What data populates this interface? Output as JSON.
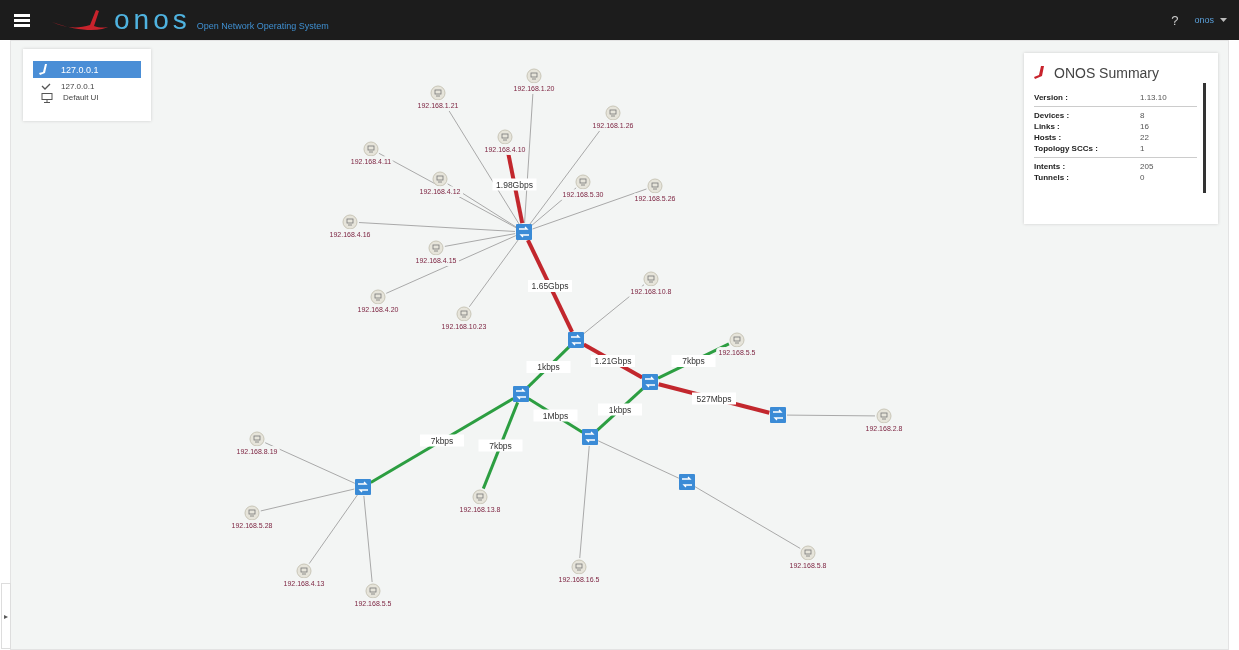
{
  "top_bar": {
    "app_name": "onos",
    "subtitle": "Open Network Operating System",
    "help": "?",
    "user": "onos"
  },
  "instance_panel": {
    "instance": {
      "label": "127.0.0.1",
      "selected": true
    },
    "details": [
      {
        "kind": "check",
        "label": "127.0.0.1"
      },
      {
        "kind": "monitor",
        "label": "Default UI"
      }
    ]
  },
  "summary_panel": {
    "title": "ONOS Summary",
    "groups": [
      [
        {
          "label": "Version :",
          "value": "1.13.10"
        }
      ],
      [
        {
          "label": "Devices :",
          "value": "8"
        },
        {
          "label": "Links :",
          "value": "16"
        },
        {
          "label": "Hosts :",
          "value": "22"
        },
        {
          "label": "Topology SCCs :",
          "value": "1"
        }
      ],
      [
        {
          "label": "Intents :",
          "value": "205"
        },
        {
          "label": "Tunnels :",
          "value": "0"
        }
      ]
    ]
  },
  "topology": {
    "hosts": [
      {
        "label": "192.168.1.20"
      },
      {
        "label": "192.168.1.21"
      },
      {
        "label": "192.168.1.26"
      },
      {
        "label": "192.168.4.10"
      },
      {
        "label": "192.168.4.11"
      },
      {
        "label": "192.168.4.12"
      },
      {
        "label": "192.168.5.30"
      },
      {
        "label": "192.168.5.26"
      },
      {
        "label": "192.168.4.16"
      },
      {
        "label": "192.168.4.15"
      },
      {
        "label": "192.168.4.20"
      },
      {
        "label": "192.168.10.23"
      },
      {
        "label": "192.168.10.8"
      },
      {
        "label": "192.168.5.5"
      },
      {
        "label": "192.168.2.8"
      },
      {
        "label": "192.168.8.19"
      },
      {
        "label": "192.168.5.28"
      },
      {
        "label": "192.168.4.13"
      },
      {
        "label": "192.168.5.5"
      },
      {
        "label": "192.168.13.8"
      },
      {
        "label": "192.168.16.5"
      },
      {
        "label": "192.168.5.8"
      }
    ],
    "links": [
      {
        "kind": "host"
      },
      {
        "kind": "host"
      },
      {
        "kind": "host"
      },
      {
        "kind": "heavy",
        "label": "1.98Gbps"
      },
      {
        "kind": "host"
      },
      {
        "kind": "host"
      },
      {
        "kind": "host"
      },
      {
        "kind": "host"
      },
      {
        "kind": "host"
      },
      {
        "kind": "host"
      },
      {
        "kind": "host"
      },
      {
        "kind": "host"
      },
      {
        "kind": "heavy",
        "label": "1.65Gbps"
      },
      {
        "kind": "host"
      },
      {
        "kind": "heavy",
        "label": "1.21Gbps"
      },
      {
        "kind": "light",
        "label": "1kbps"
      },
      {
        "kind": "light",
        "label": "7kbps"
      },
      {
        "kind": "heavy",
        "label": "527Mbps"
      },
      {
        "kind": "host"
      },
      {
        "kind": "light",
        "label": "1kbps"
      },
      {
        "kind": "light",
        "label": "1Mbps"
      },
      {
        "kind": "light",
        "label": "7kbps"
      },
      {
        "kind": "light",
        "label": "7kbps"
      },
      {
        "kind": "host"
      },
      {
        "kind": "host"
      },
      {
        "kind": "host"
      },
      {
        "kind": "host"
      },
      {
        "kind": "host"
      },
      {
        "kind": "host"
      },
      {
        "kind": "host"
      }
    ]
  },
  "panel_toggle": "▸"
}
